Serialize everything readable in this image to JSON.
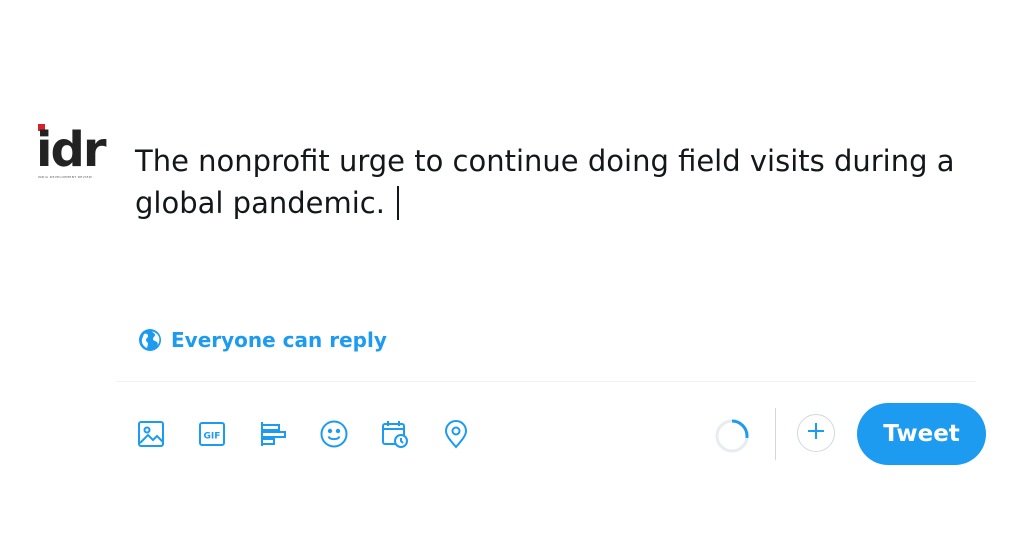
{
  "avatar": {
    "logo_text": "idr",
    "logo_subtext": "INDIA DEVELOPMENT REVIEW",
    "icon": "idr-logo"
  },
  "composer": {
    "text_line1": "The nonprofit urge to continue doing field visits during a",
    "text_line2": "global pandemic."
  },
  "reply_setting": {
    "label": "Everyone can reply",
    "icon": "globe-icon"
  },
  "toolbar": {
    "icons": [
      "image-icon",
      "gif-icon",
      "poll-icon",
      "emoji-icon",
      "schedule-icon",
      "location-icon"
    ],
    "gif_label": "GIF"
  },
  "actions": {
    "tweet_label": "Tweet",
    "add_icon": "plus-icon",
    "progress_icon": "character-count-ring",
    "char_progress": 0.27
  },
  "colors": {
    "accent": "#1d9bf0",
    "text": "#14171a",
    "logo_red": "#d9202a"
  }
}
